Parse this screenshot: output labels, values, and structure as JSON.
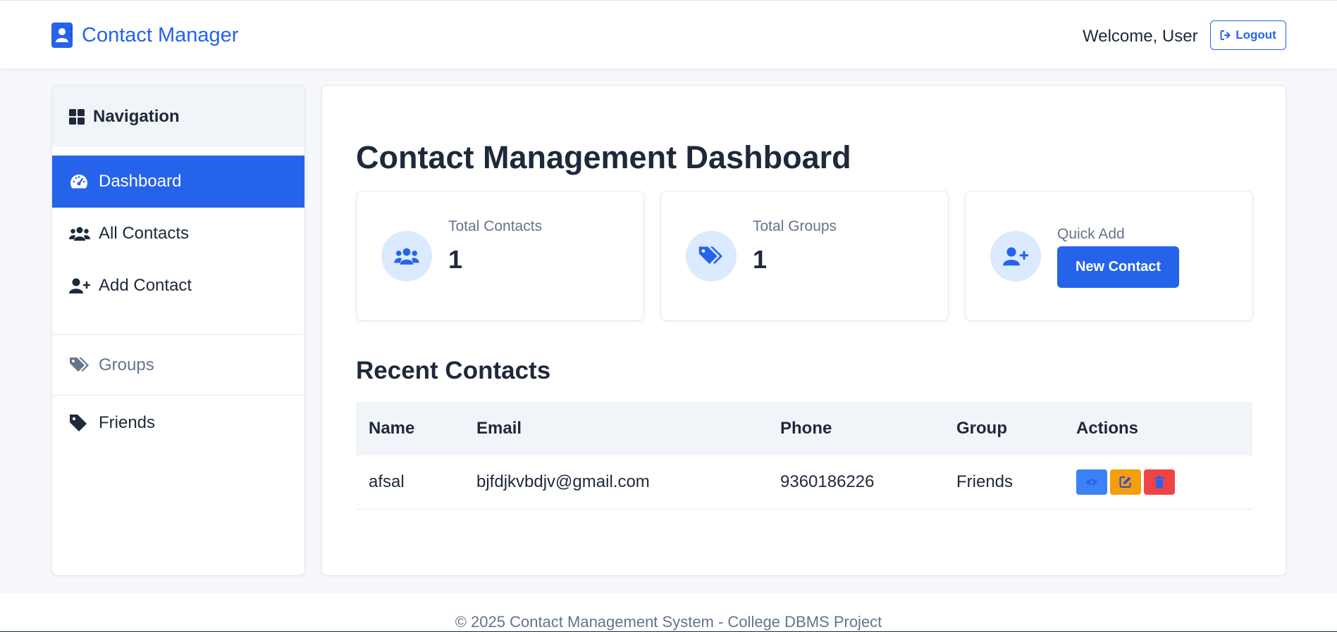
{
  "header": {
    "app_title": "Contact Manager",
    "brand_icon": "address-book-icon",
    "welcome_text": "Welcome, User",
    "logout_label": "Logout",
    "logout_icon": "sign-out-icon",
    "accent_color": "#2563eb"
  },
  "sidebar": {
    "heading": "Navigation",
    "heading_icon": "grid-icon",
    "items": [
      {
        "label": "Dashboard",
        "icon": "tachometer-icon",
        "active": true
      },
      {
        "label": "All Contacts",
        "icon": "users-icon",
        "active": false
      },
      {
        "label": "Add Contact",
        "icon": "user-plus-icon",
        "active": false
      }
    ],
    "groups_heading": "Groups",
    "groups_icon": "tags-icon",
    "groups": [
      {
        "label": "Friends",
        "icon": "tag-icon"
      }
    ]
  },
  "main": {
    "title": "Contact Management Dashboard",
    "cards": [
      {
        "label": "Total Contacts",
        "value": "1",
        "icon": "users-icon"
      },
      {
        "label": "Total Groups",
        "value": "1",
        "icon": "tags-icon"
      },
      {
        "label": "Quick Add",
        "button_label": "New Contact",
        "icon": "user-plus-icon"
      }
    ],
    "recent_title": "Recent Contacts",
    "table": {
      "columns": [
        "Name",
        "Email",
        "Phone",
        "Group",
        "Actions"
      ],
      "rows": [
        {
          "name": "afsal",
          "email": "bjfdjkvbdjv@gmail.com",
          "phone": "9360186226",
          "group": "Friends"
        }
      ],
      "actions": [
        {
          "name": "view",
          "icon": "eye-icon",
          "color": "#3b82f6"
        },
        {
          "name": "edit",
          "icon": "edit-icon",
          "color": "#f59e0b"
        },
        {
          "name": "delete",
          "icon": "trash-icon",
          "color": "#ef4444"
        }
      ]
    }
  },
  "footer": {
    "text": "© 2025 Contact Management System - College DBMS Project"
  }
}
